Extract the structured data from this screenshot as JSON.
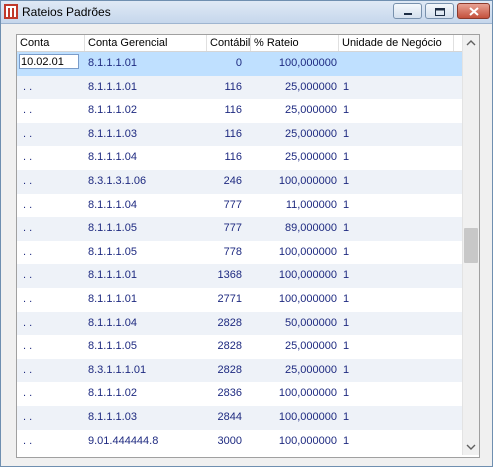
{
  "window": {
    "title": "Rateios Padrões"
  },
  "columns": [
    "Conta",
    "Conta Gerencial",
    "Contábil",
    "% Rateio",
    "Unidade de Negócio"
  ],
  "edit_value": "10.02.01",
  "rows": [
    {
      "conta": "",
      "cg": "8.1.1.1.01",
      "ct": "0",
      "rt": "100,000000",
      "un": ""
    },
    {
      "conta": ". .",
      "cg": "8.1.1.1.01",
      "ct": "116",
      "rt": "25,000000",
      "un": "1"
    },
    {
      "conta": ". .",
      "cg": "8.1.1.1.02",
      "ct": "116",
      "rt": "25,000000",
      "un": "1"
    },
    {
      "conta": ". .",
      "cg": "8.1.1.1.03",
      "ct": "116",
      "rt": "25,000000",
      "un": "1"
    },
    {
      "conta": ". .",
      "cg": "8.1.1.1.04",
      "ct": "116",
      "rt": "25,000000",
      "un": "1"
    },
    {
      "conta": ". .",
      "cg": "8.3.1.3.1.06",
      "ct": "246",
      "rt": "100,000000",
      "un": "1"
    },
    {
      "conta": ". .",
      "cg": "8.1.1.1.04",
      "ct": "777",
      "rt": "11,000000",
      "un": "1"
    },
    {
      "conta": ". .",
      "cg": "8.1.1.1.05",
      "ct": "777",
      "rt": "89,000000",
      "un": "1"
    },
    {
      "conta": ". .",
      "cg": "8.1.1.1.05",
      "ct": "778",
      "rt": "100,000000",
      "un": "1"
    },
    {
      "conta": ". .",
      "cg": "8.1.1.1.01",
      "ct": "1368",
      "rt": "100,000000",
      "un": "1"
    },
    {
      "conta": ". .",
      "cg": "8.1.1.1.01",
      "ct": "2771",
      "rt": "100,000000",
      "un": "1"
    },
    {
      "conta": ". .",
      "cg": "8.1.1.1.04",
      "ct": "2828",
      "rt": "50,000000",
      "un": "1"
    },
    {
      "conta": ". .",
      "cg": "8.1.1.1.05",
      "ct": "2828",
      "rt": "25,000000",
      "un": "1"
    },
    {
      "conta": ". .",
      "cg": "8.3.1.1.1.01",
      "ct": "2828",
      "rt": "25,000000",
      "un": "1"
    },
    {
      "conta": ". .",
      "cg": "8.1.1.1.02",
      "ct": "2836",
      "rt": "100,000000",
      "un": "1"
    },
    {
      "conta": ". .",
      "cg": "8.1.1.1.03",
      "ct": "2844",
      "rt": "100,000000",
      "un": "1"
    },
    {
      "conta": ". .",
      "cg": "9.01.444444.8",
      "ct": "3000",
      "rt": "100,000000",
      "un": "1"
    }
  ]
}
